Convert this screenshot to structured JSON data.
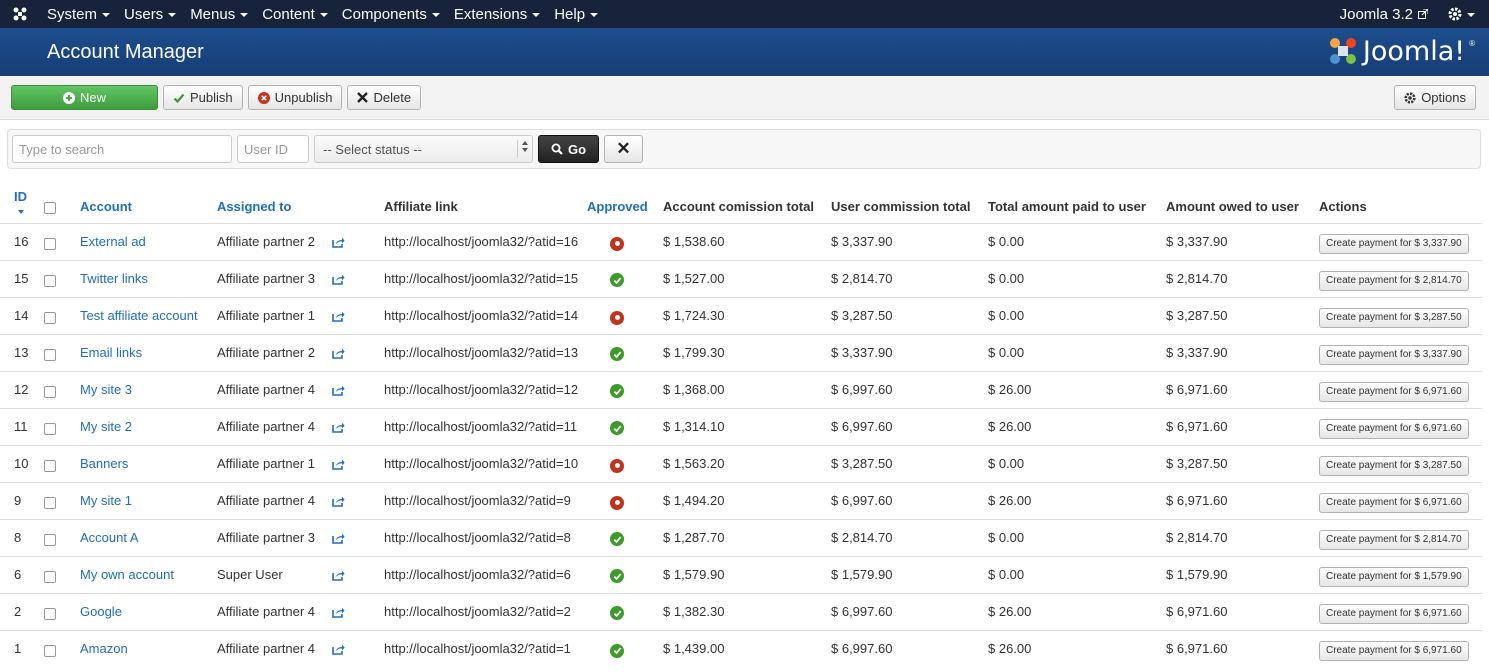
{
  "navbar": {
    "menus": [
      "System",
      "Users",
      "Menus",
      "Content",
      "Components",
      "Extensions",
      "Help"
    ],
    "site_link": "Joomla 3.2"
  },
  "header": {
    "page_title": "Account Manager",
    "brand": "Joomla!",
    "brand_reg": "®"
  },
  "toolbar": {
    "new_label": "New",
    "publish_label": "Publish",
    "unpublish_label": "Unpublish",
    "delete_label": "Delete",
    "options_label": "Options"
  },
  "filters": {
    "search_placeholder": "Type to search",
    "userid_placeholder": "User ID",
    "status_value": "-- Select status --",
    "go_label": "Go",
    "clear_label": "✕"
  },
  "table": {
    "columns": {
      "id": "ID",
      "account": "Account",
      "assigned_to": "Assigned to",
      "affiliate_link": "Affiliate link",
      "approved": "Approved",
      "account_commission_total": "Account comission total",
      "user_commission_total": "User commission total",
      "total_paid": "Total amount paid to user",
      "amount_owed": "Amount owed to user",
      "actions": "Actions"
    },
    "rows": [
      {
        "id": "16",
        "account": "External ad",
        "assigned_to": "Affiliate partner 2",
        "link": "http://localhost/joomla32/?atid=16",
        "approved": false,
        "acc_total": "$ 1,538.60",
        "user_total": "$ 3,337.90",
        "paid": "$ 0.00",
        "owed": "$ 3,337.90",
        "action": "Create payment for $ 3,337.90"
      },
      {
        "id": "15",
        "account": "Twitter links",
        "assigned_to": "Affiliate partner 3",
        "link": "http://localhost/joomla32/?atid=15",
        "approved": true,
        "acc_total": "$ 1,527.00",
        "user_total": "$ 2,814.70",
        "paid": "$ 0.00",
        "owed": "$ 2,814.70",
        "action": "Create payment for $ 2,814.70"
      },
      {
        "id": "14",
        "account": "Test affiliate account",
        "assigned_to": "Affiliate partner 1",
        "link": "http://localhost/joomla32/?atid=14",
        "approved": false,
        "acc_total": "$ 1,724.30",
        "user_total": "$ 3,287.50",
        "paid": "$ 0.00",
        "owed": "$ 3,287.50",
        "action": "Create payment for $ 3,287.50"
      },
      {
        "id": "13",
        "account": "Email links",
        "assigned_to": "Affiliate partner 2",
        "link": "http://localhost/joomla32/?atid=13",
        "approved": true,
        "acc_total": "$ 1,799.30",
        "user_total": "$ 3,337.90",
        "paid": "$ 0.00",
        "owed": "$ 3,337.90",
        "action": "Create payment for $ 3,337.90"
      },
      {
        "id": "12",
        "account": "My site 3",
        "assigned_to": "Affiliate partner 4",
        "link": "http://localhost/joomla32/?atid=12",
        "approved": true,
        "acc_total": "$ 1,368.00",
        "user_total": "$ 6,997.60",
        "paid": "$ 26.00",
        "owed": "$ 6,971.60",
        "action": "Create payment for $ 6,971.60"
      },
      {
        "id": "11",
        "account": "My site 2",
        "assigned_to": "Affiliate partner 4",
        "link": "http://localhost/joomla32/?atid=11",
        "approved": true,
        "acc_total": "$ 1,314.10",
        "user_total": "$ 6,997.60",
        "paid": "$ 26.00",
        "owed": "$ 6,971.60",
        "action": "Create payment for $ 6,971.60"
      },
      {
        "id": "10",
        "account": "Banners",
        "assigned_to": "Affiliate partner 1",
        "link": "http://localhost/joomla32/?atid=10",
        "approved": false,
        "acc_total": "$ 1,563.20",
        "user_total": "$ 3,287.50",
        "paid": "$ 0.00",
        "owed": "$ 3,287.50",
        "action": "Create payment for $ 3,287.50"
      },
      {
        "id": "9",
        "account": "My site 1",
        "assigned_to": "Affiliate partner 4",
        "link": "http://localhost/joomla32/?atid=9",
        "approved": false,
        "acc_total": "$ 1,494.20",
        "user_total": "$ 6,997.60",
        "paid": "$ 26.00",
        "owed": "$ 6,971.60",
        "action": "Create payment for $ 6,971.60"
      },
      {
        "id": "8",
        "account": "Account A",
        "assigned_to": "Affiliate partner 3",
        "link": "http://localhost/joomla32/?atid=8",
        "approved": true,
        "acc_total": "$ 1,287.70",
        "user_total": "$ 2,814.70",
        "paid": "$ 0.00",
        "owed": "$ 2,814.70",
        "action": "Create payment for $ 2,814.70"
      },
      {
        "id": "6",
        "account": "My own account",
        "assigned_to": "Super User",
        "link": "http://localhost/joomla32/?atid=6",
        "approved": true,
        "acc_total": "$ 1,579.90",
        "user_total": "$ 1,579.90",
        "paid": "$ 0.00",
        "owed": "$ 1,579.90",
        "action": "Create payment for $ 1,579.90"
      },
      {
        "id": "2",
        "account": "Google",
        "assigned_to": "Affiliate partner 4",
        "link": "http://localhost/joomla32/?atid=2",
        "approved": true,
        "acc_total": "$ 1,382.30",
        "user_total": "$ 6,997.60",
        "paid": "$ 26.00",
        "owed": "$ 6,971.60",
        "action": "Create payment for $ 6,971.60"
      },
      {
        "id": "1",
        "account": "Amazon",
        "assigned_to": "Affiliate partner 4",
        "link": "http://localhost/joomla32/?atid=1",
        "approved": true,
        "acc_total": "$ 1,439.00",
        "user_total": "$ 6,997.60",
        "paid": "$ 26.00",
        "owed": "$ 6,971.60",
        "action": "Create payment for $ 6,971.60"
      }
    ]
  },
  "icons": {
    "joomla_logo": "joomla-logo-icon",
    "external_link": "external-link-icon",
    "gear": "gear-icon",
    "plus": "plus-circle-icon",
    "check": "check-icon",
    "remove": "remove-circle-icon",
    "delete": "x-icon",
    "search": "search-icon",
    "share": "share-icon"
  },
  "colors": {
    "navbar_bg": "#17233a",
    "header_bg": "#1d4e8e",
    "link": "#1f6fbf",
    "new_button": "#4ca84c",
    "approved": "#3e9a2a",
    "not_approved": "#c0341d"
  }
}
